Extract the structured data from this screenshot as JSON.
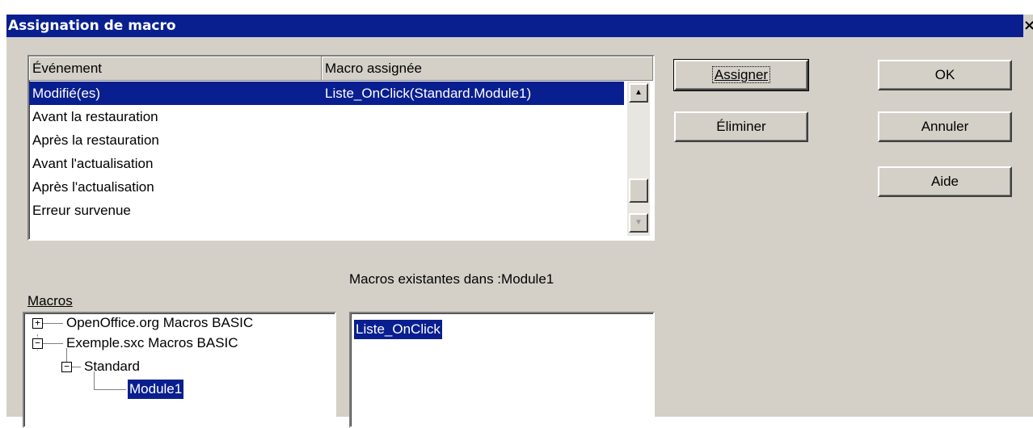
{
  "window": {
    "title": "Assignation de macro",
    "close_glyph": "×"
  },
  "events_table": {
    "columns": [
      "Événement",
      "Macro assignée"
    ],
    "rows": [
      {
        "event": "Modifié(es)",
        "macro": "Liste_OnClick(Standard.Module1)",
        "selected": true
      },
      {
        "event": "Avant la restauration",
        "macro": ""
      },
      {
        "event": "Après la restauration",
        "macro": ""
      },
      {
        "event": "Avant l'actualisation",
        "macro": ""
      },
      {
        "event": "Après l'actualisation",
        "macro": ""
      },
      {
        "event": "Erreur survenue",
        "macro": ""
      }
    ]
  },
  "buttons": {
    "assign": "Assigner",
    "remove": "Éliminer",
    "ok": "OK",
    "cancel": "Annuler",
    "help": "Aide"
  },
  "macros_label": "Macros",
  "existing_macros_label": "Macros existantes dans :Module1",
  "tree": {
    "items": [
      {
        "label": "OpenOffice.org Macros BASIC",
        "expander": "+"
      },
      {
        "label": "Exemple.sxc Macros BASIC",
        "expander": "−"
      },
      {
        "label": "Standard",
        "expander": "−"
      },
      {
        "label": "Module1",
        "selected": true
      }
    ]
  },
  "existing_macros": [
    {
      "label": "Liste_OnClick",
      "selected": true
    }
  ],
  "colors": {
    "selection": "#0a1f8f",
    "dialog_face": "#d4d0c8"
  },
  "icons": {
    "scroll_up": "scroll-up-arrow-icon",
    "scroll_down": "scroll-down-arrow-icon"
  }
}
